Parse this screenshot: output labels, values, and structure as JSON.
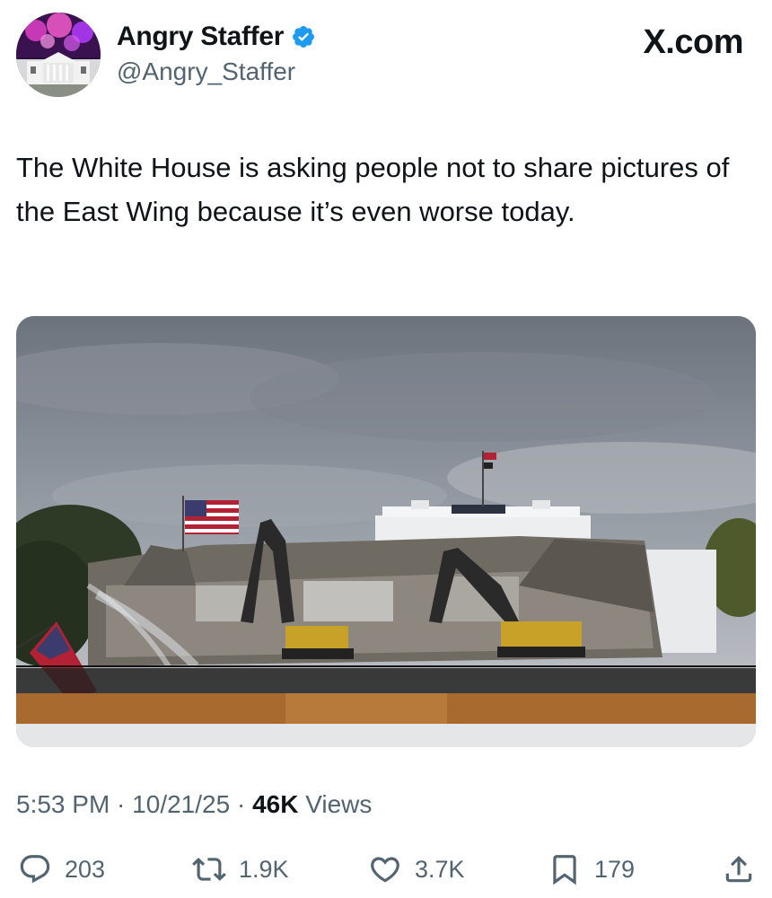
{
  "author": {
    "display_name": "Angry Staffer",
    "handle": "@Angry_Staffer",
    "verified": true,
    "verified_color": "#1d9bf0",
    "avatar_icon": "white-house-fireworks-avatar"
  },
  "brand": "X.com",
  "tweet": {
    "text": "The White House is asking people not to share pictures of the East Wing because it’s even worse today."
  },
  "media": {
    "icon": "east-wing-demolition-photo"
  },
  "meta": {
    "time": "5:53 PM",
    "separator1": " · ",
    "date": "10/21/25",
    "separator2": " · ",
    "views_count": "46K",
    "views_label": " Views"
  },
  "actions": {
    "replies": "203",
    "reposts": "1.9K",
    "likes": "3.7K",
    "bookmarks": "179"
  },
  "colors": {
    "text_primary": "#0f1419",
    "text_secondary": "#536471",
    "accent": "#1d9bf0"
  }
}
